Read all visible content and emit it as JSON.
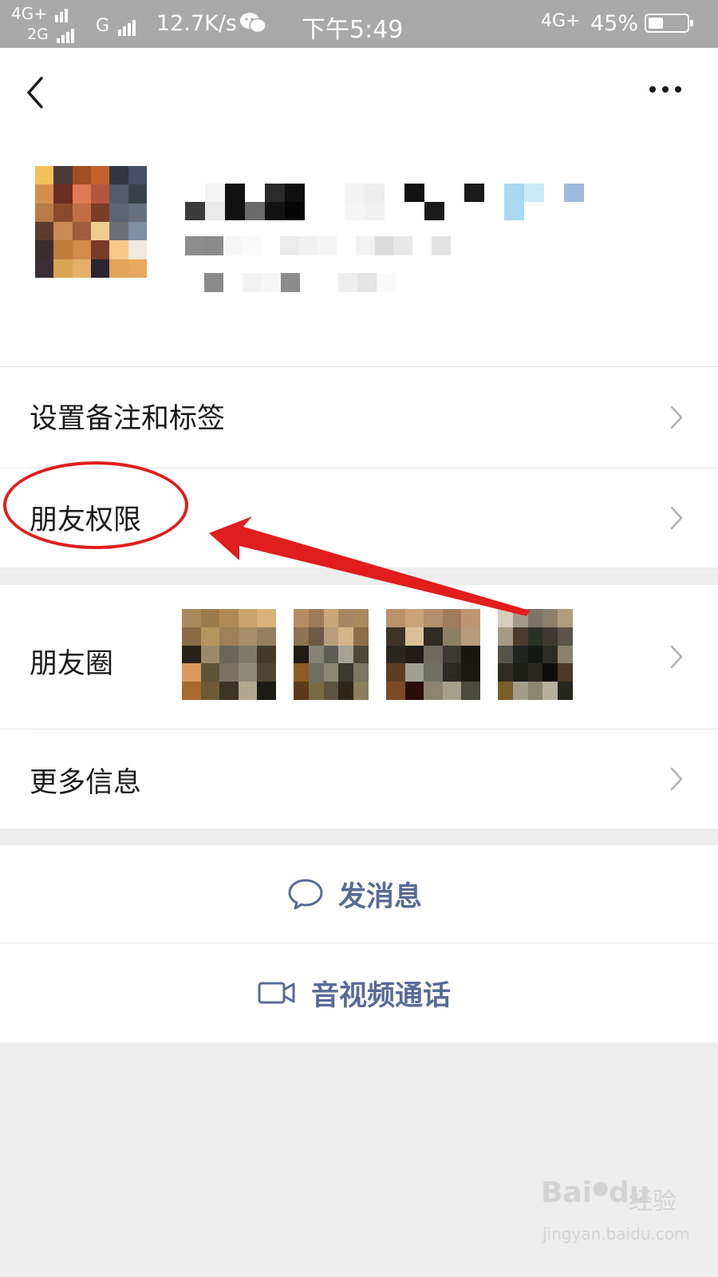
{
  "status_bar": {
    "network_1": "4G+",
    "network_2": "2G",
    "network_3": "G",
    "speed": "12.7K/s",
    "time": "下午5:49",
    "right_network": "4G",
    "right_network_suffix": "+",
    "battery_pct": "45%"
  },
  "header": {
    "back_icon": "chevron-left-icon",
    "more_icon": "ellipsis-icon"
  },
  "profile": {
    "avatar_icon": "pixelated-avatar"
  },
  "menu": {
    "remark_label": "设置备注和标签",
    "permissions_label": "朋友权限",
    "moments_label": "朋友圈",
    "more_info_label": "更多信息"
  },
  "actions": {
    "message_label": "发消息",
    "message_icon": "chat-bubble-icon",
    "call_label": "音视频通话",
    "call_icon": "video-camera-icon"
  },
  "annotation": {
    "color": "#e11d1d"
  },
  "watermark": {
    "logo": "Bai",
    "logo_suffix": "du",
    "brand_cn": "经验",
    "url": "jingyan.baidu.com"
  },
  "colors": {
    "link_blue": "#576b95",
    "page_bg": "#ededed",
    "status_bar": "#a9a9a9"
  }
}
